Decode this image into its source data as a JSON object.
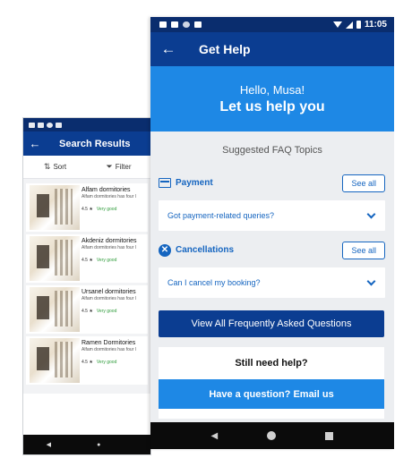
{
  "back_screen": {
    "title": "Search Results",
    "back_icon": "←",
    "sort_label": "Sort",
    "filter_label": "Filter",
    "results": [
      {
        "name": "Alfam dormitories",
        "desc": "Alfam dormitories has four l",
        "rating": "4.5 ★",
        "rating_text": "Very good"
      },
      {
        "name": "Akdeniz dormitories",
        "desc": "Alfam dormitories has four l",
        "rating": "4.5 ★",
        "rating_text": "Very good"
      },
      {
        "name": "Ursanel dormitories",
        "desc": "Alfam dormitories has four l",
        "rating": "4.5 ★",
        "rating_text": "Very good"
      },
      {
        "name": "Ramen Dormitories",
        "desc": "Alfam dormitories has four l",
        "rating": "4.5 ★",
        "rating_text": "Very good"
      }
    ],
    "nav_back": "◀",
    "nav_home": "●"
  },
  "front_screen": {
    "status_time": "11:05",
    "title": "Get Help",
    "back_icon": "←",
    "hero": {
      "greeting": "Hello, Musa!",
      "tagline": "Let us help you"
    },
    "faq_title": "Suggested FAQ Topics",
    "sections": [
      {
        "label": "Payment",
        "see_all": "See all",
        "question": "Got payment-related queries?"
      },
      {
        "label": "Cancellations",
        "see_all": "See all",
        "question": "Can I cancel my booking?"
      }
    ],
    "view_all_label": "View All Frequently Asked Questions",
    "still_need_help": "Still need help?",
    "email_label": "Have a question? Email us",
    "nav_back": "◀"
  },
  "colors": {
    "primary_dark": "#0b3d91",
    "primary_light": "#1e88e5",
    "status_bar": "#0a2d6e",
    "rating_good": "#2e9b3a"
  }
}
